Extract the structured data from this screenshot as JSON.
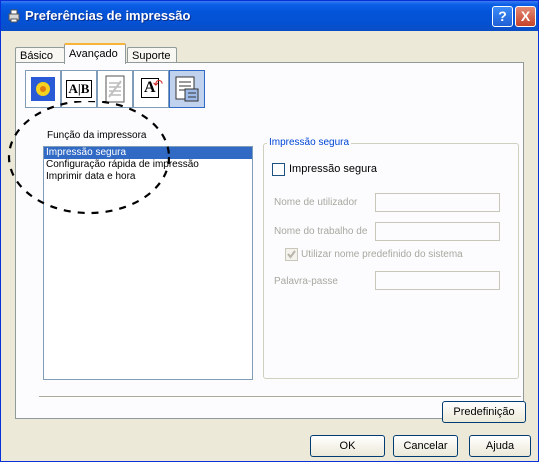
{
  "window": {
    "title": "Preferências de impressão",
    "help_button": "?",
    "close_button": "X"
  },
  "tabs": [
    {
      "label": "Básico",
      "active": false
    },
    {
      "label": "Avançado",
      "active": true
    },
    {
      "label": "Suporte",
      "active": false
    }
  ],
  "toolbar": {
    "icons": [
      "quality-icon",
      "duplex-icon",
      "watermark-icon",
      "font-icon",
      "device-options-icon"
    ],
    "duplex_text": "A|B",
    "font_text": "A"
  },
  "function_list": {
    "label": "Função da impressora",
    "items": [
      {
        "label": "Impressão segura",
        "selected": true
      },
      {
        "label": "Configuração rápida de impressão",
        "selected": false
      },
      {
        "label": "Imprimir data e hora",
        "selected": false
      }
    ]
  },
  "secure_print": {
    "group_title": "Impressão segura",
    "checkbox_label": "Impressão segura",
    "checkbox_checked": false,
    "user_name_label": "Nome de utilizador",
    "job_name_label": "Nome do trabalho de",
    "use_default_label": "Utilizar nome predefinido do sistema",
    "use_default_checked": true,
    "password_label": "Palavra-passe",
    "user_name_value": "",
    "job_name_value": "",
    "password_value": ""
  },
  "buttons": {
    "default": "Predefinição",
    "ok": "OK",
    "cancel": "Cancelar",
    "help": "Ajuda"
  },
  "colors": {
    "titlebar": "#0453d8",
    "selection": "#316ac5",
    "group_title": "#0046d5",
    "tab_highlight": "#f8b33a"
  }
}
